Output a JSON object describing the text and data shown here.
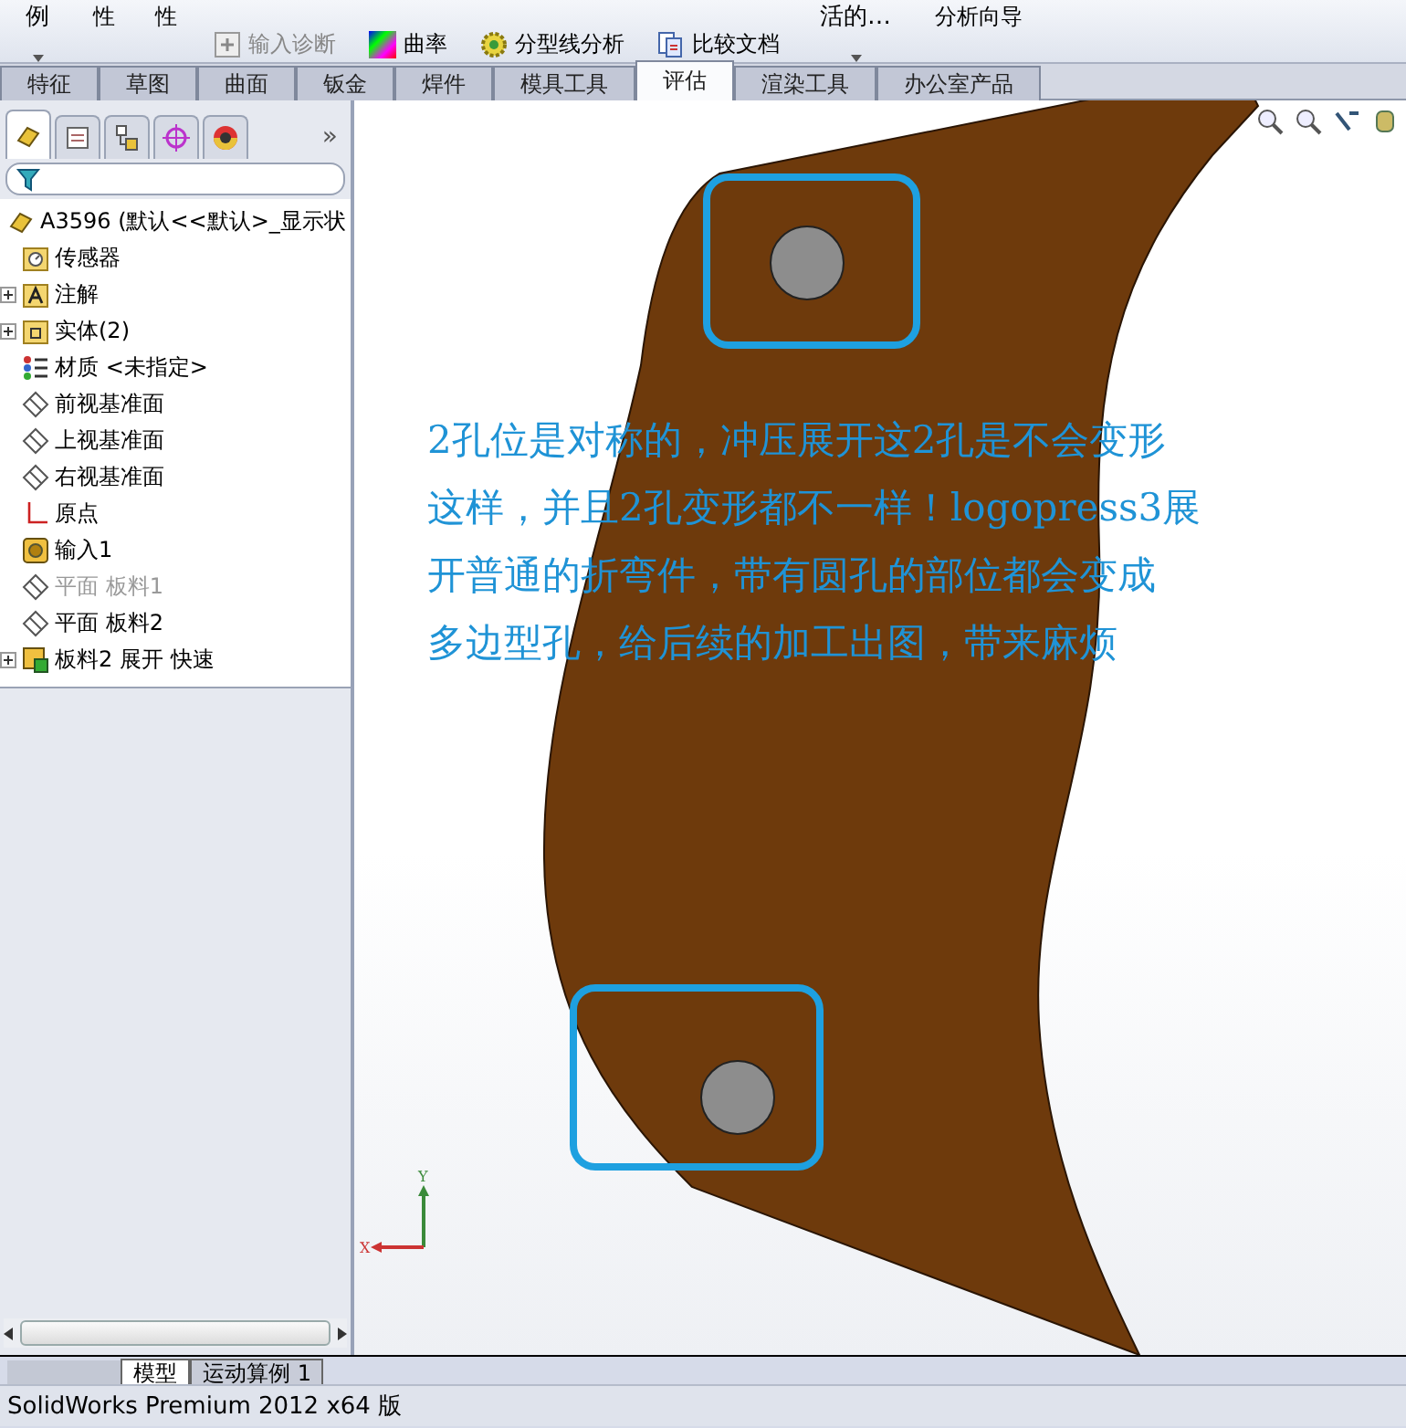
{
  "toolbar": {
    "items": [
      {
        "kind": "dropdown",
        "label": "例"
      },
      {
        "kind": "second-line",
        "label": "性"
      },
      {
        "kind": "second-line",
        "label": "性"
      },
      {
        "kind": "small",
        "label": "输入诊断",
        "disabled": true
      },
      {
        "kind": "small",
        "label": "曲率",
        "disabled": false
      },
      {
        "kind": "small",
        "label": "分型线分析",
        "disabled": false
      },
      {
        "kind": "small",
        "label": "比较文档",
        "disabled": false
      },
      {
        "kind": "dropdown",
        "label": "活的…"
      },
      {
        "kind": "second-line",
        "label": "分析向导"
      }
    ]
  },
  "tabs": [
    {
      "label": "特征",
      "selected": false
    },
    {
      "label": "草图",
      "selected": false
    },
    {
      "label": "曲面",
      "selected": false
    },
    {
      "label": "钣金",
      "selected": false
    },
    {
      "label": "焊件",
      "selected": false
    },
    {
      "label": "模具工具",
      "selected": false
    },
    {
      "label": "评估",
      "selected": true
    },
    {
      "label": "渲染工具",
      "selected": false
    },
    {
      "label": "办公室产品",
      "selected": false
    }
  ],
  "panel_tabs": [
    {
      "kind": "part",
      "selected": true
    },
    {
      "kind": "property",
      "selected": false
    },
    {
      "kind": "config",
      "selected": false
    },
    {
      "kind": "target",
      "selected": false
    },
    {
      "kind": "appearance",
      "selected": false
    }
  ],
  "panel_more": "»",
  "tree": {
    "root": {
      "label": "A3596  (默认<<默认>_显示状"
    },
    "items": [
      {
        "kind": "sensor",
        "label": "传感器",
        "disabled": false
      },
      {
        "kind": "annotation",
        "label": "注解",
        "expanded": false,
        "disabled": false
      },
      {
        "kind": "folder",
        "label": "实体(2)",
        "expanded": false,
        "disabled": false
      },
      {
        "kind": "material",
        "label": "材质 <未指定>",
        "disabled": false
      },
      {
        "kind": "plane",
        "label": "前视基准面",
        "disabled": false
      },
      {
        "kind": "plane",
        "label": "上视基准面",
        "disabled": false
      },
      {
        "kind": "plane",
        "label": "右视基准面",
        "disabled": false
      },
      {
        "kind": "origin",
        "label": "原点",
        "disabled": false
      },
      {
        "kind": "import",
        "label": "输入1",
        "disabled": false
      },
      {
        "kind": "plane",
        "label": "平面 板料1",
        "disabled": true
      },
      {
        "kind": "plane",
        "label": "平面 板料2",
        "disabled": false
      },
      {
        "kind": "flatten",
        "label": "板料2 展开 快速",
        "expanded": false,
        "disabled": false
      }
    ]
  },
  "annotation": {
    "lines": [
      "2孔位是对称的，冲压展开这2孔是不会变形",
      "这样，并且2孔变形都不一样！logopress3展",
      "开普通的折弯件，带有圆孔的部位都会变成",
      "多边型孔，给后续的加工出图，带来麻烦"
    ]
  },
  "triad": {
    "x_label": "X",
    "y_label": "Y"
  },
  "bottom_tabs": [
    {
      "label": "模型",
      "selected": true
    },
    {
      "label": "运动算例 1",
      "selected": false
    }
  ],
  "status_bar": {
    "text": "SolidWorks Premium 2012 x64 版"
  }
}
